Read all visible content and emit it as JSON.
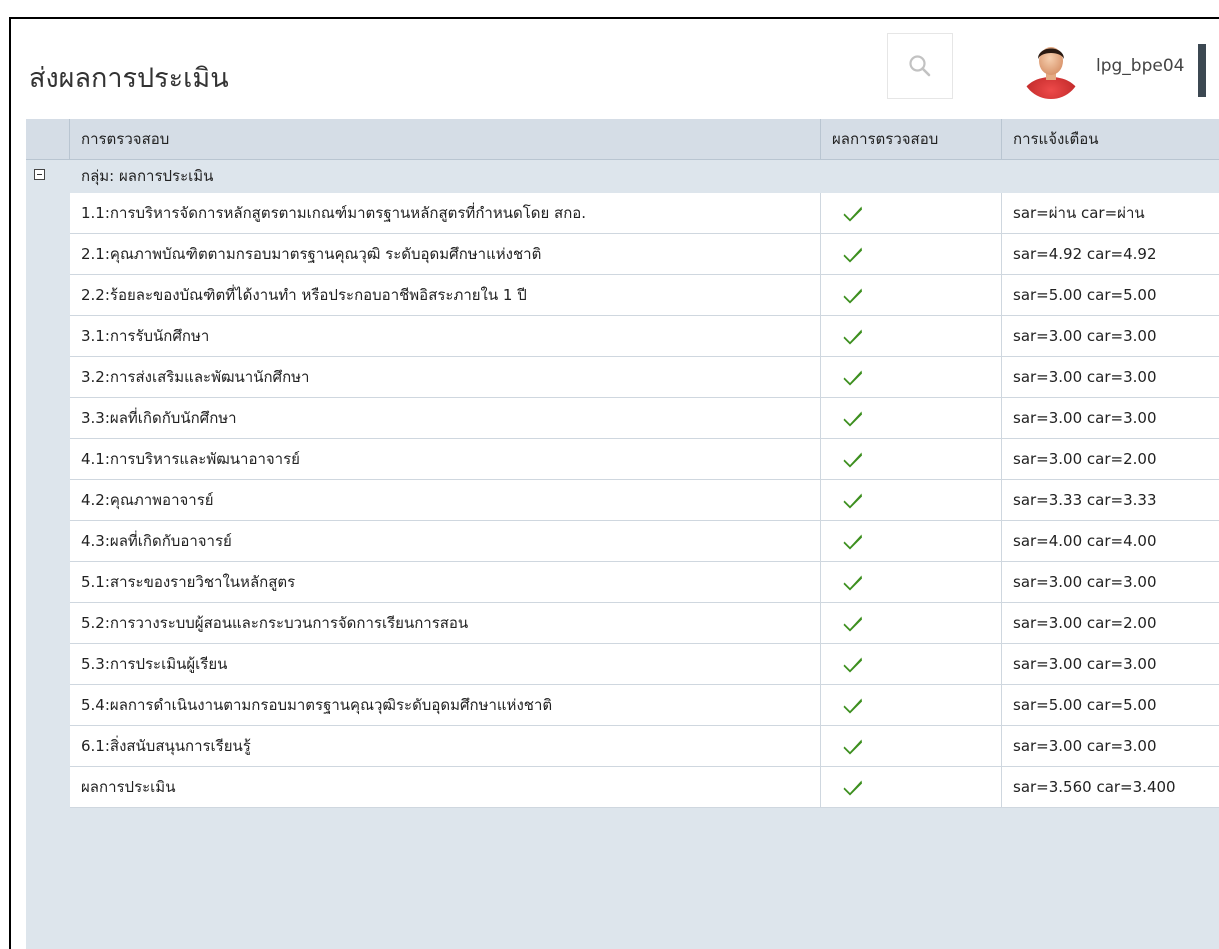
{
  "header": {
    "title": "ส่งผลการประเมิน",
    "username": "lpg_bpe04"
  },
  "table": {
    "columns": [
      "การตรวจสอบ",
      "ผลการตรวจสอบ",
      "การแจ้งเตือน"
    ],
    "group_label": "กลุ่ม: ผลการประเมิน",
    "rows": [
      {
        "name": "1.1:การบริหารจัดการหลักสูตรตามเกณฑ์มาตรฐานหลักสูตรที่กำหนดโดย สกอ.",
        "notice": "sar=ผ่าน car=ผ่าน",
        "passed": true
      },
      {
        "name": "2.1:คุณภาพบัณฑิตตามกรอบมาตรฐานคุณวุฒิ ระดับอุดมศึกษาแห่งชาติ",
        "notice": "sar=4.92 car=4.92",
        "passed": true
      },
      {
        "name": "2.2:ร้อยละของบัณฑิตที่ได้งานทำ หรือประกอบอาชีพอิสระภายใน 1 ปี",
        "notice": "sar=5.00 car=5.00",
        "passed": true
      },
      {
        "name": "3.1:การรับนักศึกษา",
        "notice": "sar=3.00 car=3.00",
        "passed": true
      },
      {
        "name": "3.2:การส่งเสริมและพัฒนานักศึกษา",
        "notice": "sar=3.00 car=3.00",
        "passed": true
      },
      {
        "name": "3.3:ผลที่เกิดกับนักศึกษา",
        "notice": "sar=3.00 car=3.00",
        "passed": true
      },
      {
        "name": "4.1:การบริหารและพัฒนาอาจารย์",
        "notice": "sar=3.00 car=2.00",
        "passed": true
      },
      {
        "name": "4.2:คุณภาพอาจารย์",
        "notice": "sar=3.33 car=3.33",
        "passed": true
      },
      {
        "name": "4.3:ผลที่เกิดกับอาจารย์",
        "notice": "sar=4.00 car=4.00",
        "passed": true
      },
      {
        "name": "5.1:สาระของรายวิชาในหลักสูตร",
        "notice": "sar=3.00 car=3.00",
        "passed": true
      },
      {
        "name": "5.2:การวางระบบผู้สอนและกระบวนการจัดการเรียนการสอน",
        "notice": "sar=3.00 car=2.00",
        "passed": true
      },
      {
        "name": "5.3:การประเมินผู้เรียน",
        "notice": "sar=3.00 car=3.00",
        "passed": true
      },
      {
        "name": "5.4:ผลการดำเนินงานตามกรอบมาตรฐานคุณวุฒิระดับอุดมศึกษาแห่งชาติ",
        "notice": "sar=5.00 car=5.00",
        "passed": true
      },
      {
        "name": "6.1:สิ่งสนับสนุนการเรียนรู้",
        "notice": "sar=3.00 car=3.00",
        "passed": true
      },
      {
        "name": "ผลการประเมิน",
        "notice": "sar=3.560 car=3.400",
        "passed": true
      }
    ]
  },
  "icons": {
    "search": "search-icon",
    "avatar": "user-avatar-icon",
    "expander": "collapse-icon",
    "check": "check-icon"
  },
  "colors": {
    "check": "#3d8f1f",
    "header_bg": "#d5dde6",
    "group_bg": "#dde5ec",
    "avatar_shirt": "#d42a2a"
  }
}
